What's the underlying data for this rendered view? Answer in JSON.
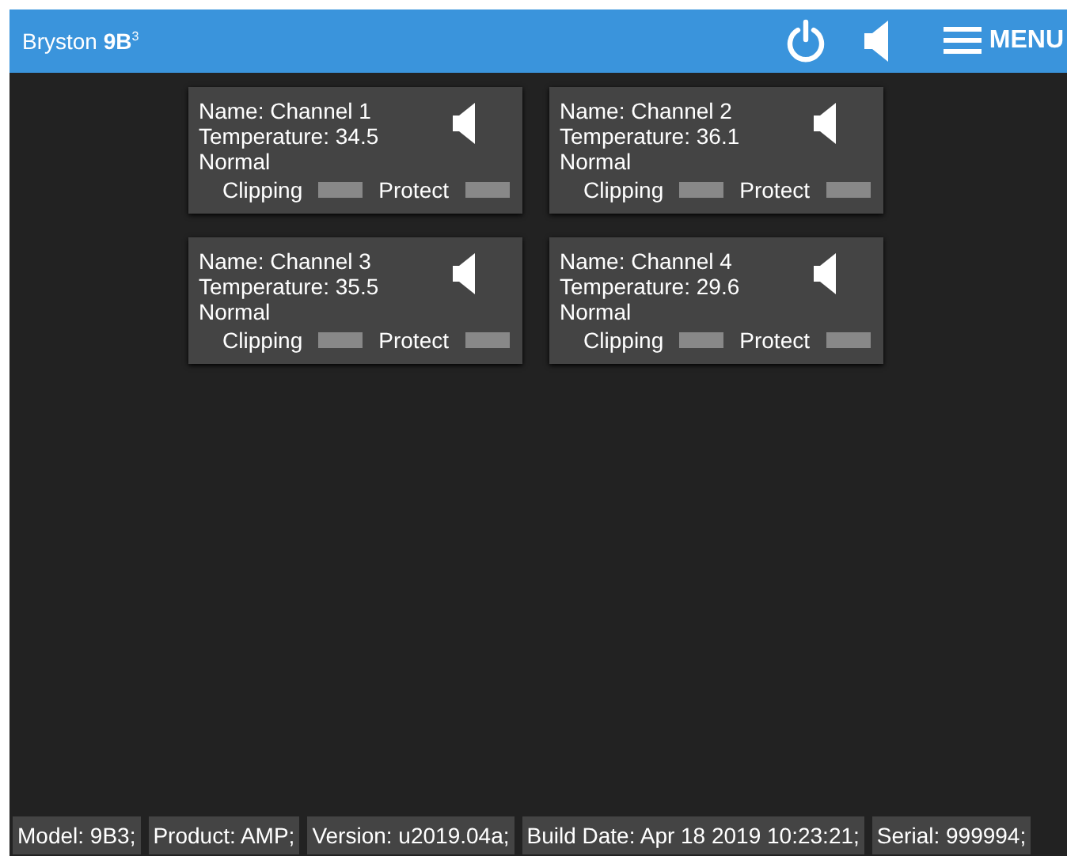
{
  "header": {
    "brand": "Bryston **9B**$^{3}$",
    "menu_label": "MENU"
  },
  "channels": [
    {
      "name": "Name: Channel 1",
      "temperature": "Temperature: 34.5",
      "status": "Normal",
      "indicators": [
        {
          "label": "Clipping",
          "on": false
        },
        {
          "label": "Protect",
          "on": false
        }
      ]
    },
    {
      "name": "Name: Channel 2",
      "temperature": "Temperature: 36.1",
      "status": "Normal",
      "indicators": [
        {
          "label": "Clipping",
          "on": false
        },
        {
          "label": "Protect",
          "on": false
        }
      ]
    },
    {
      "name": "Name: Channel 3",
      "temperature": "Temperature: 35.5",
      "status": "Normal",
      "indicators": [
        {
          "label": "Clipping",
          "on": false
        },
        {
          "label": "Protect",
          "on": false
        }
      ]
    },
    {
      "name": "Name: Channel 4",
      "temperature": "Temperature: 29.6",
      "status": "Normal",
      "indicators": [
        {
          "label": "Clipping",
          "on": false
        },
        {
          "label": "Protect",
          "on": false
        }
      ]
    }
  ],
  "status_bar": [
    "Model: 9B3;",
    "Product: AMP;",
    "Version: u2019.04a;",
    "Build Date: Apr 18 2019 10:23:21;",
    "Serial: 999994;"
  ]
}
